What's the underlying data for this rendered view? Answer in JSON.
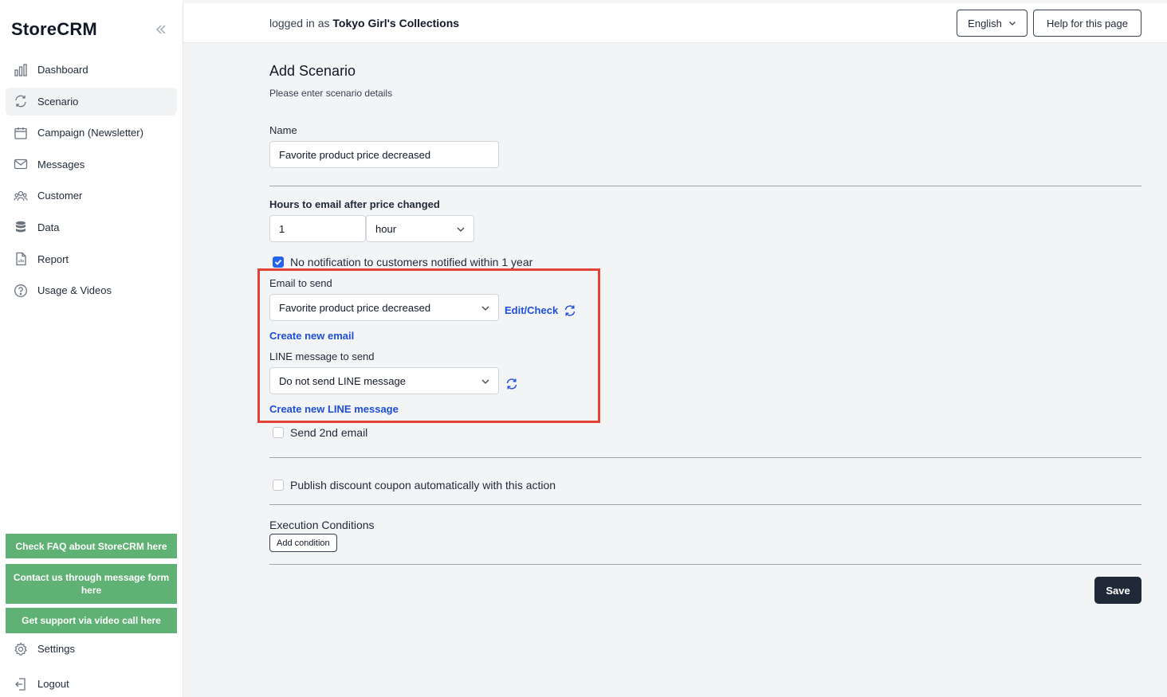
{
  "sidebar": {
    "brand": "StoreCRM",
    "items": [
      {
        "label": "Dashboard",
        "icon": "bar-chart-icon"
      },
      {
        "label": "Scenario",
        "icon": "refresh-cycle-icon"
      },
      {
        "label": "Campaign (Newsletter)",
        "icon": "calendar-icon"
      },
      {
        "label": "Messages",
        "icon": "envelope-icon"
      },
      {
        "label": "Customer",
        "icon": "users-icon"
      },
      {
        "label": "Data",
        "icon": "database-icon"
      },
      {
        "label": "Report",
        "icon": "document-icon"
      },
      {
        "label": "Usage & Videos",
        "icon": "question-circle-icon"
      }
    ],
    "support": {
      "faq": "Check FAQ about StoreCRM here",
      "contact": "Contact us through message form here",
      "video": "Get support via video call here"
    },
    "settings": "Settings",
    "logout": "Logout"
  },
  "header": {
    "logged_prefix": "logged in as",
    "store_name": "Tokyo Girl's Collections",
    "language": "English",
    "help": "Help for this page"
  },
  "form": {
    "title": "Add Scenario",
    "subtitle": "Please enter scenario details",
    "name_label": "Name",
    "name_value": "Favorite product price decreased",
    "hours_label": "Hours to email after price changed",
    "hours_value": "1",
    "unit_value": "hour",
    "no_notify_label": "No notification to customers notified within 1 year",
    "no_notify_checked": true,
    "email_label": "Email to send",
    "email_value": "Favorite product price decreased",
    "edit_check": "Edit/Check",
    "create_email": "Create new email",
    "line_label": "LINE message to send",
    "line_value": "Do not send LINE message",
    "create_line": "Create new LINE message",
    "second_email_label": "Send 2nd email",
    "coupon_label": "Publish discount coupon automatically with this action",
    "exec_title": "Execution Conditions",
    "add_condition": "Add condition",
    "save": "Save"
  },
  "colors": {
    "support_green": "#5fb274",
    "link_blue": "#1d4ed8",
    "highlight_red": "#e34234",
    "save_dark": "#1f2937"
  }
}
